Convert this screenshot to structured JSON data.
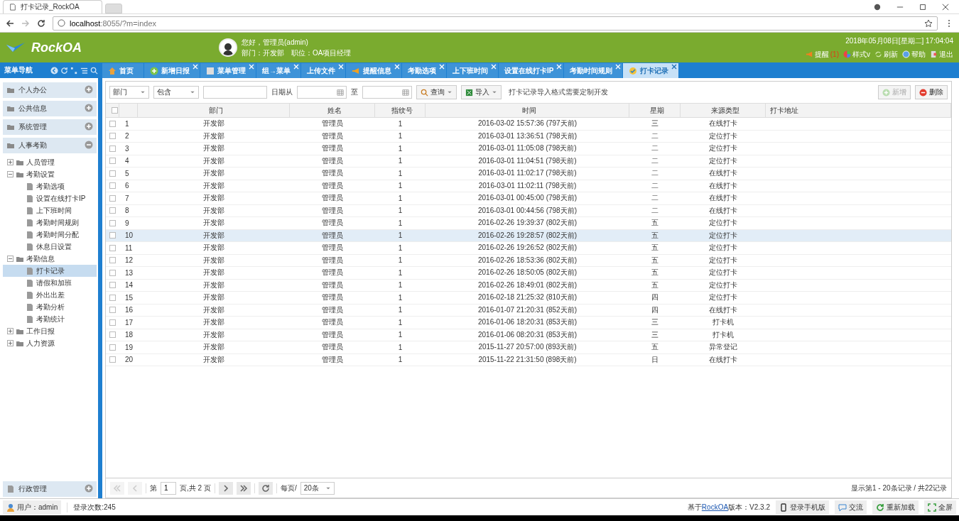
{
  "browser": {
    "tab_title": "打卡记录_RockOA",
    "address_host": "localhost",
    "address_rest": ":8055/?m=index"
  },
  "header": {
    "logo": "RockOA",
    "greeting": "您好，管理员(admin)",
    "department": "部门：开发部",
    "position": "职位：OA项目经理",
    "datetime": "2018年05月08日[星期二] 17:04:04",
    "links": [
      {
        "label": "提醒",
        "badge": "(1)"
      },
      {
        "label": "样式v"
      },
      {
        "label": "刷新"
      },
      {
        "label": "帮助"
      },
      {
        "label": "退出"
      }
    ]
  },
  "nav": {
    "title": "菜单导航"
  },
  "tabs": [
    {
      "label": "首页",
      "closable": false,
      "selected": false
    },
    {
      "label": "新增日报",
      "closable": true,
      "selected": false
    },
    {
      "label": "菜单管理",
      "closable": true,
      "selected": false
    },
    {
      "label": "组→菜单",
      "closable": true,
      "selected": false
    },
    {
      "label": "上传文件",
      "closable": true,
      "selected": false
    },
    {
      "label": "提醒信息",
      "closable": true,
      "selected": false
    },
    {
      "label": "考勤选项",
      "closable": true,
      "selected": false
    },
    {
      "label": "上下班时间",
      "closable": true,
      "selected": false
    },
    {
      "label": "设置在线打卡IP",
      "closable": true,
      "selected": false
    },
    {
      "label": "考勤时间规则",
      "closable": true,
      "selected": false
    },
    {
      "label": "打卡记录",
      "closable": true,
      "selected": true
    }
  ],
  "sidebar": {
    "groups": [
      {
        "label": "个人办公",
        "expanded": false
      },
      {
        "label": "公共信息",
        "expanded": false
      },
      {
        "label": "系统管理",
        "expanded": false
      },
      {
        "label": "人事考勤",
        "expanded": true,
        "items": [
          {
            "label": "人员管理",
            "kind": "branch",
            "expanded": false,
            "selected": false
          },
          {
            "label": "考勤设置",
            "kind": "branch",
            "expanded": true,
            "selected": false,
            "children": [
              {
                "label": "考勤选项",
                "kind": "leaf",
                "selected": false
              },
              {
                "label": "设置在线打卡IP",
                "kind": "leaf",
                "selected": false
              },
              {
                "label": "上下班时间",
                "kind": "leaf",
                "selected": false
              },
              {
                "label": "考勤时间规则",
                "kind": "leaf",
                "selected": false
              },
              {
                "label": "考勤时间分配",
                "kind": "leaf",
                "selected": false
              },
              {
                "label": "休息日设置",
                "kind": "leaf",
                "selected": false
              }
            ]
          },
          {
            "label": "考勤信息",
            "kind": "branch",
            "expanded": true,
            "selected": false,
            "children": [
              {
                "label": "打卡记录",
                "kind": "leaf",
                "selected": true
              },
              {
                "label": "请假和加班",
                "kind": "leaf",
                "selected": false
              },
              {
                "label": "外出出差",
                "kind": "leaf",
                "selected": false
              },
              {
                "label": "考勤分析",
                "kind": "leaf",
                "selected": false
              },
              {
                "label": "考勤统计",
                "kind": "leaf",
                "selected": false
              }
            ]
          },
          {
            "label": "工作日报",
            "kind": "branch",
            "expanded": false,
            "selected": false
          },
          {
            "label": "人力资源",
            "kind": "branch",
            "expanded": false,
            "selected": false
          }
        ]
      }
    ],
    "bottom_group": {
      "label": "行政管理",
      "expanded": false
    }
  },
  "toolbar": {
    "field_select": "部门",
    "match_select": "包含",
    "date_from_label": "日期从",
    "date_to_label": "至",
    "search_button": "查询",
    "import_button": "导入",
    "note": "打卡记录导入格式需要定制开发",
    "add_button": {
      "label": "新增",
      "disabled": true
    },
    "delete_button": {
      "label": "删除",
      "disabled": false
    }
  },
  "table": {
    "header_checked": false,
    "columns": [
      "部门",
      "姓名",
      "指纹号",
      "时间",
      "星期",
      "来源类型",
      "打卡地址"
    ],
    "rows": [
      {
        "no": "1",
        "dept": "开发部",
        "name": "管理员",
        "fp": "1",
        "time": "2016-03-02 15:57:36 (797天前)",
        "weekday": "三",
        "source": "在线打卡",
        "checked": false,
        "selected": false
      },
      {
        "no": "2",
        "dept": "开发部",
        "name": "管理员",
        "fp": "1",
        "time": "2016-03-01 13:36:51 (798天前)",
        "weekday": "二",
        "source": "定位打卡",
        "checked": false,
        "selected": false
      },
      {
        "no": "3",
        "dept": "开发部",
        "name": "管理员",
        "fp": "1",
        "time": "2016-03-01 11:05:08 (798天前)",
        "weekday": "二",
        "source": "定位打卡",
        "checked": false,
        "selected": false
      },
      {
        "no": "4",
        "dept": "开发部",
        "name": "管理员",
        "fp": "1",
        "time": "2016-03-01 11:04:51 (798天前)",
        "weekday": "二",
        "source": "定位打卡",
        "checked": false,
        "selected": false
      },
      {
        "no": "5",
        "dept": "开发部",
        "name": "管理员",
        "fp": "1",
        "time": "2016-03-01 11:02:17 (798天前)",
        "weekday": "二",
        "source": "在线打卡",
        "checked": false,
        "selected": false
      },
      {
        "no": "6",
        "dept": "开发部",
        "name": "管理员",
        "fp": "1",
        "time": "2016-03-01 11:02:11 (798天前)",
        "weekday": "二",
        "source": "在线打卡",
        "checked": false,
        "selected": false
      },
      {
        "no": "7",
        "dept": "开发部",
        "name": "管理员",
        "fp": "1",
        "time": "2016-03-01 00:45:00 (798天前)",
        "weekday": "二",
        "source": "在线打卡",
        "checked": false,
        "selected": false
      },
      {
        "no": "8",
        "dept": "开发部",
        "name": "管理员",
        "fp": "1",
        "time": "2016-03-01 00:44:56 (798天前)",
        "weekday": "二",
        "source": "在线打卡",
        "checked": false,
        "selected": false
      },
      {
        "no": "9",
        "dept": "开发部",
        "name": "管理员",
        "fp": "1",
        "time": "2016-02-26 19:39:37 (802天前)",
        "weekday": "五",
        "source": "定位打卡",
        "checked": false,
        "selected": false
      },
      {
        "no": "10",
        "dept": "开发部",
        "name": "管理员",
        "fp": "1",
        "time": "2016-02-26 19:28:57 (802天前)",
        "weekday": "五",
        "source": "定位打卡",
        "checked": false,
        "selected": true
      },
      {
        "no": "11",
        "dept": "开发部",
        "name": "管理员",
        "fp": "1",
        "time": "2016-02-26 19:26:52 (802天前)",
        "weekday": "五",
        "source": "定位打卡",
        "checked": false,
        "selected": false
      },
      {
        "no": "12",
        "dept": "开发部",
        "name": "管理员",
        "fp": "1",
        "time": "2016-02-26 18:53:36 (802天前)",
        "weekday": "五",
        "source": "定位打卡",
        "checked": false,
        "selected": false
      },
      {
        "no": "13",
        "dept": "开发部",
        "name": "管理员",
        "fp": "1",
        "time": "2016-02-26 18:50:05 (802天前)",
        "weekday": "五",
        "source": "定位打卡",
        "checked": false,
        "selected": false
      },
      {
        "no": "14",
        "dept": "开发部",
        "name": "管理员",
        "fp": "1",
        "time": "2016-02-26 18:49:01 (802天前)",
        "weekday": "五",
        "source": "定位打卡",
        "checked": false,
        "selected": false
      },
      {
        "no": "15",
        "dept": "开发部",
        "name": "管理员",
        "fp": "1",
        "time": "2016-02-18 21:25:32 (810天前)",
        "weekday": "四",
        "source": "定位打卡",
        "checked": false,
        "selected": false
      },
      {
        "no": "16",
        "dept": "开发部",
        "name": "管理员",
        "fp": "1",
        "time": "2016-01-07 21:20:31 (852天前)",
        "weekday": "四",
        "source": "在线打卡",
        "checked": false,
        "selected": false
      },
      {
        "no": "17",
        "dept": "开发部",
        "name": "管理员",
        "fp": "1",
        "time": "2016-01-06 18:20:31 (853天前)",
        "weekday": "三",
        "source": "打卡机",
        "checked": false,
        "selected": false
      },
      {
        "no": "18",
        "dept": "开发部",
        "name": "管理员",
        "fp": "1",
        "time": "2016-01-06 08:20:31 (853天前)",
        "weekday": "三",
        "source": "打卡机",
        "checked": false,
        "selected": false
      },
      {
        "no": "19",
        "dept": "开发部",
        "name": "管理员",
        "fp": "1",
        "time": "2015-11-27 20:57:00 (893天前)",
        "weekday": "五",
        "source": "异常登记",
        "checked": false,
        "selected": false
      },
      {
        "no": "20",
        "dept": "开发部",
        "name": "管理员",
        "fp": "1",
        "time": "2015-11-22 21:31:50 (898天前)",
        "weekday": "日",
        "source": "在线打卡",
        "checked": false,
        "selected": false
      }
    ]
  },
  "pager": {
    "page_label": "第",
    "page": "1",
    "total_label": "页,共 2 页",
    "per_page_label": "每页/",
    "per_page": "20条",
    "summary": "显示第1 - 20条记录 / 共22记录",
    "first_disabled": true,
    "prev_disabled": true,
    "next_disabled": false,
    "last_disabled": false
  },
  "status_bar": {
    "user": "用户：admin",
    "login_count": "登录次数:245",
    "version_prefix": "基于",
    "version_link": "RockOA",
    "version_suffix": "版本：V2.3.2",
    "buttons": [
      "登录手机版",
      "交流",
      "重新加载",
      "全屏"
    ]
  }
}
